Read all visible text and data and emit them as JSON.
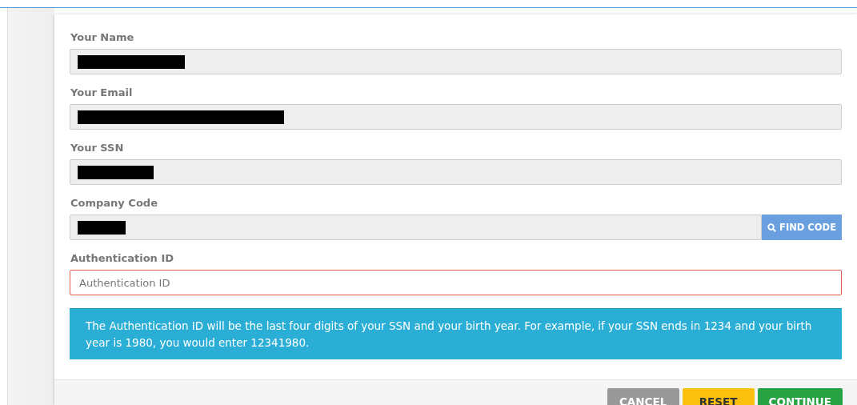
{
  "fields": [
    {
      "label": "Your Name",
      "kind": "readonly",
      "redacted": true
    },
    {
      "label": "Your Email",
      "kind": "readonly",
      "redacted": true
    },
    {
      "label": "Your SSN",
      "kind": "readonly",
      "redacted": true
    },
    {
      "label": "Company Code",
      "kind": "readonly_button",
      "redacted": true,
      "button": {
        "label": "FIND CODE"
      }
    },
    {
      "label": "Authentication ID",
      "kind": "input",
      "invalid": true,
      "placeholder": "Authentication ID"
    }
  ],
  "alert": "The Authentication ID will be the last four digits of your SSN and your birth year. For example, if your SSN ends in 1234 and your birth year is 1980, you would enter 12341980.",
  "buttons": [
    {
      "label": "CANCEL",
      "kind": "default"
    },
    {
      "label": "RESET",
      "kind": "warning"
    },
    {
      "label": "CONTINUE",
      "kind": "success"
    }
  ]
}
